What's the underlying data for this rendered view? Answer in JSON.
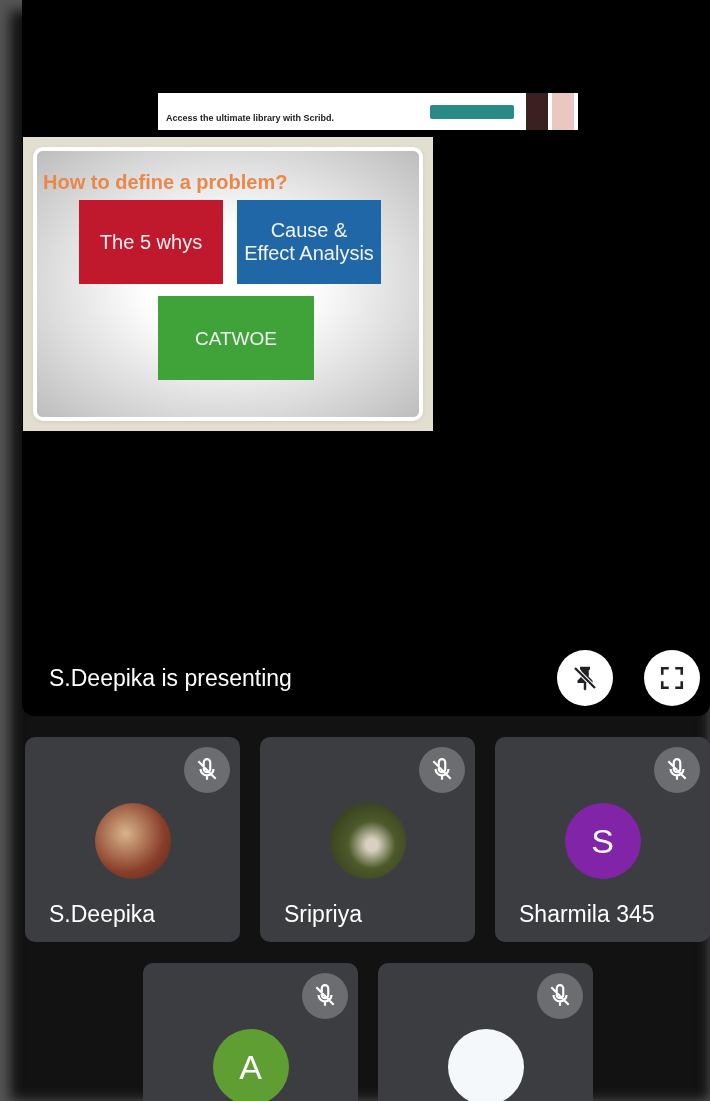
{
  "ad": {
    "text": "Access the ultimate library with Scribd."
  },
  "slide": {
    "title": "How to define a problem?",
    "blocks": [
      {
        "label": "The 5 whys",
        "color": "#c0182c"
      },
      {
        "label": "Cause & Effect Analysis",
        "color": "#1f67a6"
      },
      {
        "label": "CATWOE",
        "color": "#3fa33a"
      }
    ]
  },
  "presenting": {
    "caption": "S.Deepika is presenting"
  },
  "participants": [
    {
      "name": "S.Deepika",
      "muted": true,
      "avatar": {
        "kind": "photo"
      }
    },
    {
      "name": "Sripriya",
      "muted": true,
      "avatar": {
        "kind": "photo"
      }
    },
    {
      "name": "Sharmila 345",
      "muted": true,
      "avatar": {
        "kind": "initial",
        "letter": "S",
        "color": "#8224a8"
      }
    },
    {
      "muted": true,
      "avatar": {
        "kind": "initial",
        "letter": "A",
        "color": "#5f9e33"
      }
    },
    {
      "muted": true,
      "avatar": {
        "kind": "logo"
      }
    }
  ]
}
